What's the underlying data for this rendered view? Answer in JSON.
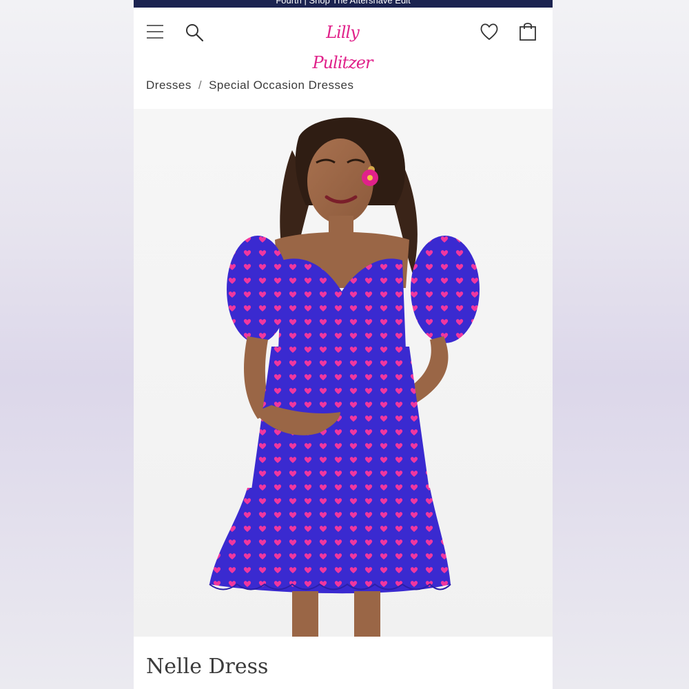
{
  "promo_banner": {
    "text": "Fourth | Shop The Aftershave Edit"
  },
  "header": {
    "menu_icon": "hamburger-menu-icon",
    "search_icon": "search-icon",
    "logo_text": "Lilly Pulitzer",
    "wishlist_icon": "heart-icon",
    "bag_icon": "shopping-bag-icon"
  },
  "breadcrumb": {
    "items": [
      "Dresses",
      "Special Occasion Dresses"
    ],
    "separator": "/"
  },
  "product": {
    "image_description": "model wearing heart-print puff-sleeve dress",
    "name": "Nelle Dress"
  },
  "colors": {
    "brand_pink": "#e0218a",
    "banner_navy": "#1b2350",
    "dress_blue": "#3a2ad0",
    "heart_pink": "#f0379f"
  }
}
